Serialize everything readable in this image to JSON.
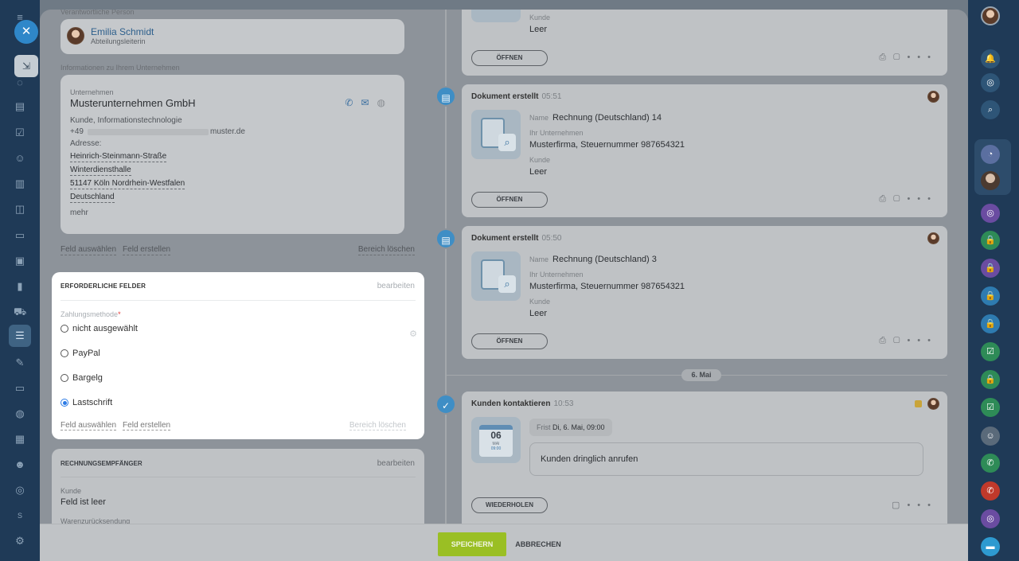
{
  "contact": {
    "section_label": "Verantwortliche Person",
    "name": "Emilia Schmidt",
    "role": "Abteilungsleiterin"
  },
  "company_section": {
    "label": "Informationen zu Ihrem Unternehmen",
    "field_label": "Unternehmen",
    "company_name": "Musterunternehmen GmbH",
    "company_type": "Kunde, Informationstechnologie",
    "phone": "+49",
    "email_suffix": "muster.de",
    "address_label": "Adresse:",
    "address_lines": [
      "Heinrich-Steinmann-Straße",
      "Winterdiensthalle",
      "51147 Köln Nordrhein-Westfalen",
      "Deutschland"
    ],
    "more": "mehr",
    "select_field": "Feld auswählen",
    "create_field": "Feld erstellen",
    "delete_section": "Bereich löschen"
  },
  "required_fields": {
    "title": "ERFORDERLICHE FELDER",
    "edit": "bearbeiten",
    "field_label": "Zahlungsmethode",
    "required_mark": "*",
    "options": [
      "nicht ausgewählt",
      "PayPal",
      "Bargelg",
      "Lastschrift"
    ],
    "selected": "Lastschrift",
    "select_field": "Feld auswählen",
    "create_field": "Feld erstellen",
    "delete_section": "Bereich löschen"
  },
  "recipient": {
    "title": "RECHNUNGSEMPFÄNGER",
    "edit": "bearbeiten",
    "customer_label": "Kunde",
    "customer_value": "Feld ist leer",
    "returns_label": "Warenzurücksendung"
  },
  "timeline": {
    "top_card": {
      "field_label": "Kunde",
      "field_value": "Leer",
      "open_button": "ÖFFNEN"
    },
    "doc1": {
      "title": "Dokument erstellt",
      "time": "05:51",
      "name_label": "Name",
      "name_value": "Rechnung (Deutschland) 14",
      "company_label": "Ihr Unternehmen",
      "company_value": "Musterfirma, Steuernummer 987654321",
      "customer_label": "Kunde",
      "customer_value": "Leer",
      "open_button": "ÖFFNEN"
    },
    "doc2": {
      "title": "Dokument erstellt",
      "time": "05:50",
      "name_label": "Name",
      "name_value": "Rechnung (Deutschland) 3",
      "company_label": "Ihr Unternehmen",
      "company_value": "Musterfirma, Steuernummer 987654321",
      "customer_label": "Kunde",
      "customer_value": "Leer",
      "open_button": "ÖFFNEN"
    },
    "day_separator": "6. Mai",
    "task": {
      "title": "Kunden kontaktieren",
      "time": "10:53",
      "calendar_day": "06",
      "calendar_month": "MAI",
      "calendar_time": "09:00",
      "deadline_label": "Frist",
      "deadline_value": "Di, 6. Mai, 09:00",
      "description": "Kunden dringlich anrufen",
      "repeat_button": "WIEDERHOLEN"
    }
  },
  "footer": {
    "save": "SPEICHERN",
    "cancel": "ABBRECHEN"
  },
  "sidebar_user_initial": "S",
  "close_icon": "✕",
  "colors": {
    "accent": "#2c7be5",
    "save": "#9abf24",
    "sidebar": "#1f3a57"
  }
}
